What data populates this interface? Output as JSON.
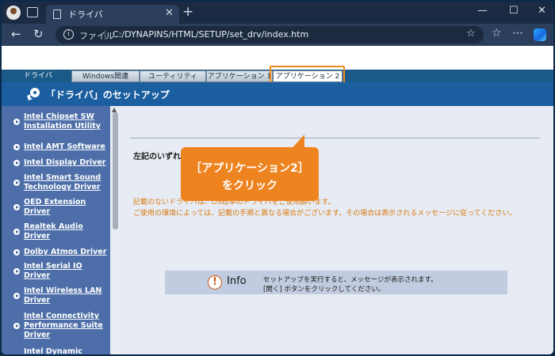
{
  "browser": {
    "tab_title": "ドライバ",
    "tab_close": "✕",
    "new_tab": "+",
    "url_label": "ファイル",
    "url": "C:/DYNAPINS/HTML/SETUP/set_drv/index.htm",
    "window_controls": [
      "—",
      "☐",
      "✕"
    ],
    "nav_icons": [
      "back-icon",
      "refresh-icon"
    ],
    "right_icons": [
      "favorites-icon",
      "more-icon",
      "copilot-icon"
    ]
  },
  "menu": {
    "tabs": [
      "ドライバ",
      "Windows関連",
      "ユーティリティ",
      "アプリケーション 1",
      "アプリケーション 2"
    ],
    "highlighted": "アプリケーション 2"
  },
  "header": {
    "title": "「ドライバ」のセットアップ"
  },
  "sidebar": {
    "items": [
      {
        "label": "Intel Chipset SW Installation Utility"
      },
      {
        "label": "Intel AMT Software"
      },
      {
        "label": "Intel Display Driver"
      },
      {
        "label": "Intel Smart Sound Technology Driver"
      },
      {
        "label": "OED Extension Driver"
      },
      {
        "label": "Realtek Audio Driver"
      },
      {
        "label": "Dolby Atmos Driver"
      },
      {
        "label": "Intel Serial IO Driver"
      },
      {
        "label": "Intel Wireless LAN Driver"
      },
      {
        "label": "Intel Connectivity Performance Suite Driver"
      },
      {
        "label": "Intel Dynamic"
      }
    ]
  },
  "main": {
    "lead": "左記のいずれ",
    "notes": [
      "記載のないドライバは、OS標準のドライバをご使用願います。",
      "ご使用の環境によっては、記載の手順と異なる場合がございます。その場合は表示されるメッセージに従ってください。"
    ],
    "info": {
      "icon": "!",
      "label": "Info",
      "lines": [
        "セットアップを実行すると、メッセージが表示されます。",
        "[開く] ボタンをクリックしてください。"
      ]
    }
  },
  "callout": {
    "line1": "［アプリケーション2］",
    "line2": "をクリック",
    "color": "#ee8420"
  }
}
